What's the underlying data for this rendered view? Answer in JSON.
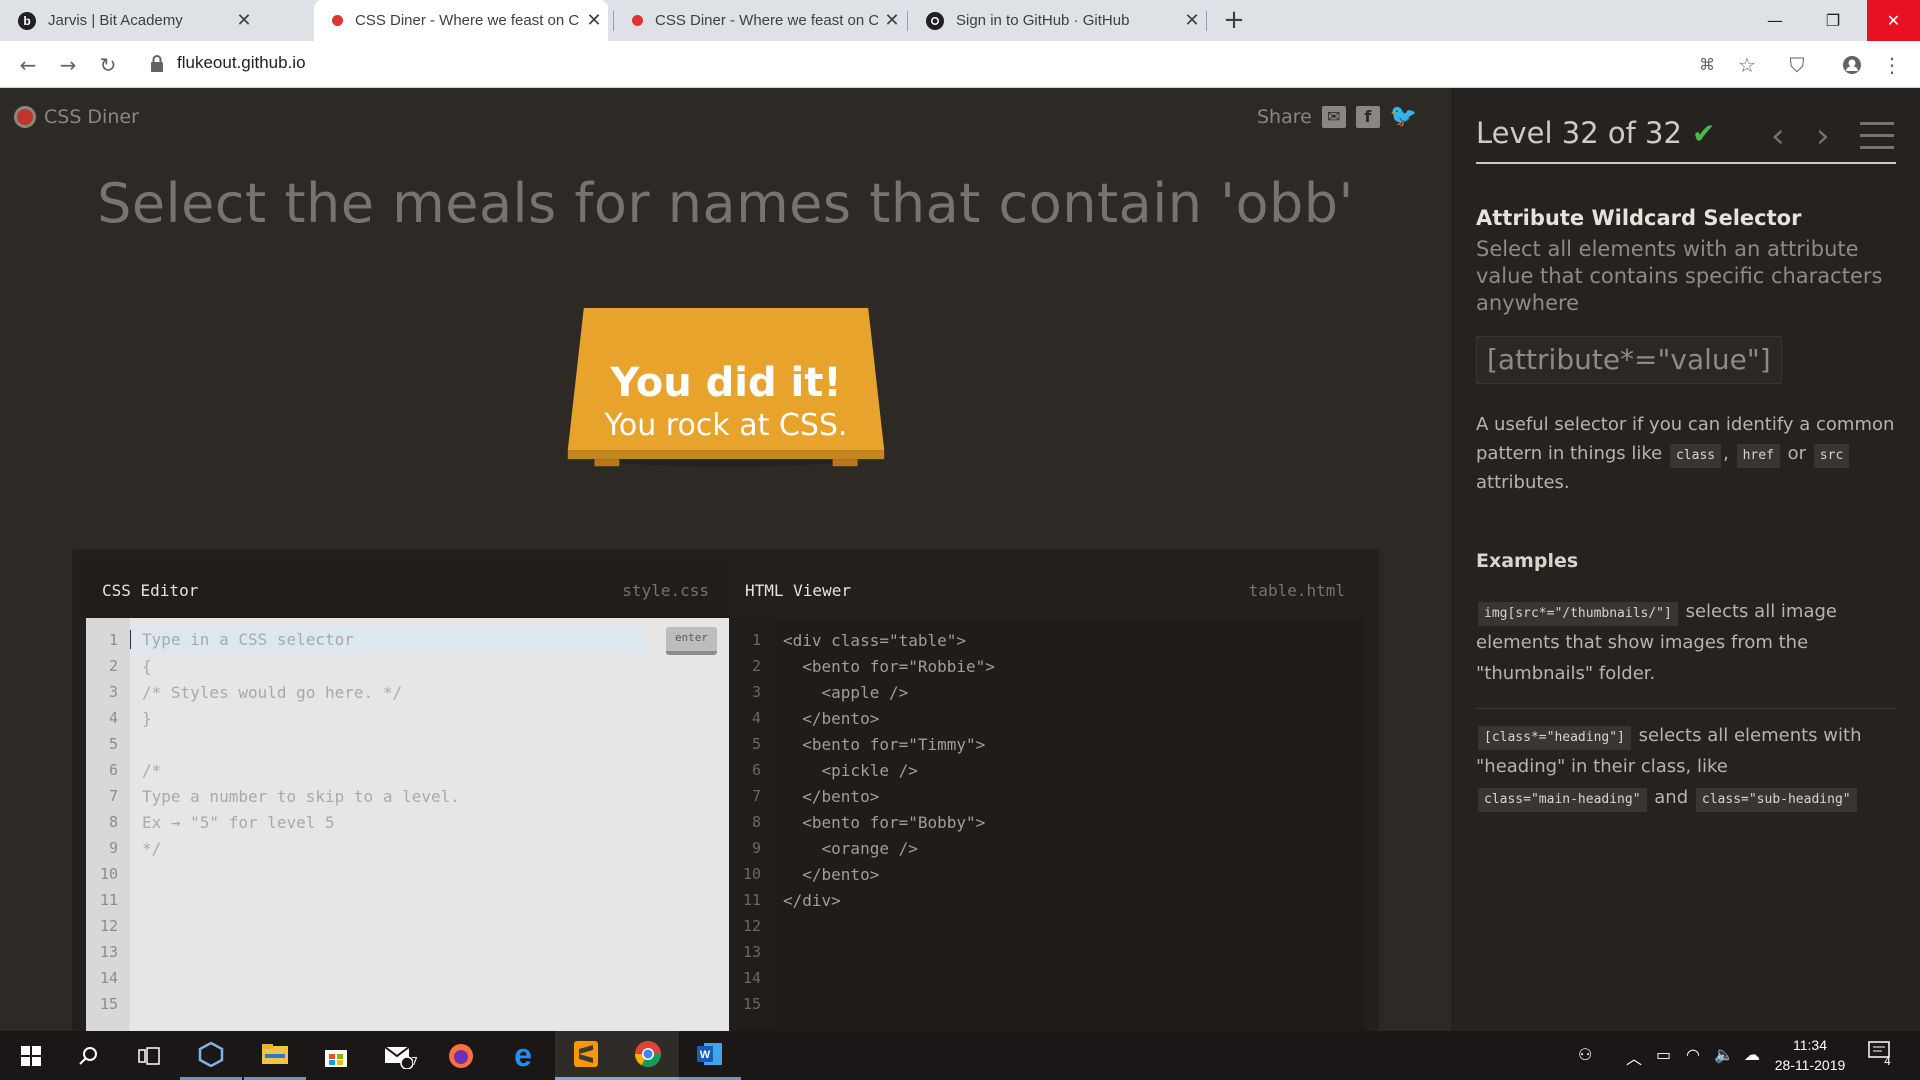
{
  "browser": {
    "tabs": [
      {
        "title": "Jarvis | Bit Academy",
        "favicon": "b-letter-icon"
      },
      {
        "title": "CSS Diner - Where we feast on C",
        "favicon": "css-diner-icon"
      },
      {
        "title": "CSS Diner - Where we feast on C",
        "favicon": "css-diner-icon"
      },
      {
        "title": "Sign in to GitHub · GitHub",
        "favicon": "github-icon"
      }
    ],
    "url": "flukeout.github.io"
  },
  "game": {
    "logo_text": "CSS Diner",
    "share_label": "Share",
    "instruction": "Select the meals for names that contain 'obb'",
    "table_text_1": "You did it!",
    "table_text_2": "You rock at CSS.",
    "css_editor": {
      "title": "CSS Editor",
      "filename": "style.css",
      "input_placeholder": "Type in a CSS selector",
      "enter_label": "enter",
      "lines": [
        "{",
        "/* Styles would go here. */",
        "}",
        "",
        "/*",
        "Type a number to skip to a level.",
        "Ex → \"5\" for level 5",
        "*/"
      ],
      "line_numbers": [
        "1",
        "2",
        "3",
        "4",
        "5",
        "6",
        "7",
        "8",
        "9",
        "10",
        "11",
        "12",
        "13",
        "14",
        "15"
      ]
    },
    "html_viewer": {
      "title": "HTML Viewer",
      "filename": "table.html",
      "lines": [
        "<div class=\"table\">",
        "  <bento for=\"Robbie\">",
        "    <apple />",
        "  </bento>",
        "  <bento for=\"Timmy\">",
        "    <pickle />",
        "  </bento>",
        "  <bento for=\"Bobby\">",
        "    <orange />",
        "  </bento>",
        "</div>"
      ],
      "line_numbers": [
        "1",
        "2",
        "3",
        "4",
        "5",
        "6",
        "7",
        "8",
        "9",
        "10",
        "11",
        "12",
        "13",
        "14",
        "15"
      ]
    }
  },
  "sidebar": {
    "level_text": "Level 32 of 32",
    "progress": 1.0,
    "selector_name": "Attribute Wildcard Selector",
    "selector_title": "Select all elements with an attribute value that contains specific characters anywhere",
    "syntax": "[attribute*=\"value\"]",
    "hint_1": "A useful selector if you can identify a common pattern in things like",
    "hint_code_1": "class",
    "hint_sep": ",",
    "hint_code_2": "href",
    "hint_or": "or",
    "hint_code_3": "src",
    "hint_2": "attributes.",
    "examples_heading": "Examples",
    "example_1_code": "img[src*=\"/thumbnails/\"]",
    "example_1_text": "selects all image elements that show images from the \"thumbnails\" folder.",
    "example_2_code": "[class*=\"heading\"]",
    "example_2_text": "selects all elements with \"heading\" in their class, like",
    "example_2_code_b": "class=\"main-heading\"",
    "example_2_and": "and",
    "example_2_code_c": "class=\"sub-heading\""
  },
  "taskbar": {
    "time": "11:34",
    "date": "28-11-2019",
    "mail_badge": "7",
    "notification_count": "4"
  },
  "colors": {
    "table": "#e8a32c",
    "check": "#4cb84c",
    "background": "#2d2a26"
  }
}
